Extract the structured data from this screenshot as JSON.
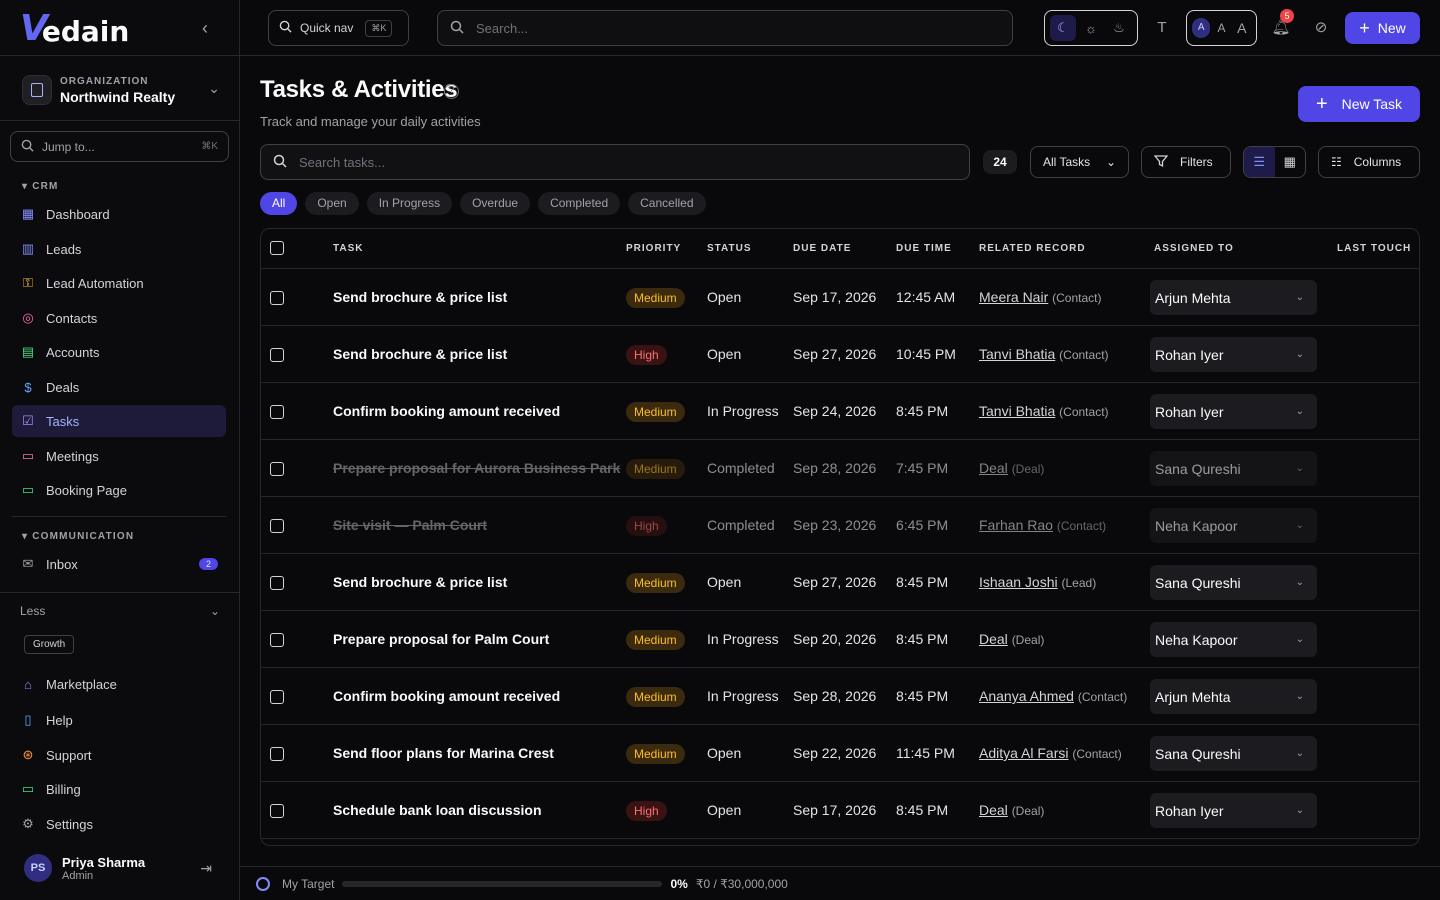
{
  "app": {
    "logo_mark": "V",
    "logo_text": "edain"
  },
  "org": {
    "label": "ORGANIZATION",
    "name": "Northwind Realty"
  },
  "jump": {
    "placeholder": "Jump to...",
    "shortcut": "⌘K"
  },
  "sidebar": {
    "crm_title": "CRM",
    "crm_items": [
      {
        "label": "Dashboard",
        "icon": "dashboard-icon"
      },
      {
        "label": "Leads",
        "icon": "leads-icon"
      },
      {
        "label": "Lead Automation",
        "icon": "automation-icon"
      },
      {
        "label": "Contacts",
        "icon": "contacts-icon"
      },
      {
        "label": "Accounts",
        "icon": "accounts-icon"
      },
      {
        "label": "Deals",
        "icon": "dollar-icon"
      },
      {
        "label": "Tasks",
        "icon": "tasks-icon",
        "active": true
      },
      {
        "label": "Meetings",
        "icon": "calendar-icon"
      },
      {
        "label": "Booking Page",
        "icon": "booking-icon"
      }
    ],
    "comm_title": "COMMUNICATION",
    "comm_items": [
      {
        "label": "Inbox",
        "icon": "inbox-icon",
        "badge": "2"
      }
    ],
    "less_label": "Less",
    "growth_label": "Growth",
    "footer_items": [
      {
        "label": "Marketplace",
        "icon": "marketplace-icon"
      },
      {
        "label": "Help",
        "icon": "book-icon"
      },
      {
        "label": "Support",
        "icon": "support-icon"
      },
      {
        "label": "Billing",
        "icon": "billing-icon"
      },
      {
        "label": "Settings",
        "icon": "settings-icon"
      }
    ],
    "user": {
      "initials": "PS",
      "name": "Priya Sharma",
      "role": "Admin"
    }
  },
  "topbar": {
    "quicknav_label": "Quick nav",
    "quicknav_shortcut": "⌘K",
    "search_placeholder": "Search...",
    "font_sizes": [
      "A",
      "A",
      "A"
    ],
    "notification_count": "5",
    "new_label": "New"
  },
  "page": {
    "title": "Tasks & Activities",
    "subtitle": "Track and manage your daily activities",
    "new_task_label": "New Task",
    "search_placeholder": "Search tasks...",
    "count": "24",
    "view_select": "All Tasks",
    "filters_label": "Filters",
    "columns_label": "Columns",
    "tabs": [
      "All",
      "Open",
      "In Progress",
      "Overdue",
      "Completed",
      "Cancelled"
    ],
    "active_tab": "All"
  },
  "table": {
    "columns": [
      "TASK",
      "PRIORITY",
      "STATUS",
      "DUE DATE",
      "DUE TIME",
      "RELATED RECORD",
      "ASSIGNED TO",
      "LAST TOUCH"
    ],
    "rows": [
      {
        "task": "Send brochure & price list",
        "priority": "Medium",
        "status": "Open",
        "due_date": "Sep 17, 2026",
        "due_time": "12:45 AM",
        "related_name": "Meera Nair",
        "related_type": "(Contact)",
        "assigned": "Arjun Mehta",
        "done": false
      },
      {
        "task": "Send brochure & price list",
        "priority": "High",
        "status": "Open",
        "due_date": "Sep 27, 2026",
        "due_time": "10:45 PM",
        "related_name": "Tanvi Bhatia",
        "related_type": "(Contact)",
        "assigned": "Rohan Iyer",
        "done": false
      },
      {
        "task": "Confirm booking amount received",
        "priority": "Medium",
        "status": "In Progress",
        "due_date": "Sep 24, 2026",
        "due_time": "8:45 PM",
        "related_name": "Tanvi Bhatia",
        "related_type": "(Contact)",
        "assigned": "Rohan Iyer",
        "done": false
      },
      {
        "task": "Prepare proposal for Aurora Business Park",
        "priority": "Medium",
        "status": "Completed",
        "due_date": "Sep 28, 2026",
        "due_time": "7:45 PM",
        "related_name": "Deal",
        "related_type": "(Deal)",
        "assigned": "Sana Qureshi",
        "done": true
      },
      {
        "task": "Site visit — Palm Court",
        "priority": "High",
        "status": "Completed",
        "due_date": "Sep 23, 2026",
        "due_time": "6:45 PM",
        "related_name": "Farhan Rao",
        "related_type": "(Contact)",
        "assigned": "Neha Kapoor",
        "done": true
      },
      {
        "task": "Send brochure & price list",
        "priority": "Medium",
        "status": "Open",
        "due_date": "Sep 27, 2026",
        "due_time": "8:45 PM",
        "related_name": "Ishaan Joshi",
        "related_type": "(Lead)",
        "assigned": "Sana Qureshi",
        "done": false
      },
      {
        "task": "Prepare proposal for Palm Court",
        "priority": "Medium",
        "status": "In Progress",
        "due_date": "Sep 20, 2026",
        "due_time": "8:45 PM",
        "related_name": "Deal",
        "related_type": "(Deal)",
        "assigned": "Neha Kapoor",
        "done": false
      },
      {
        "task": "Confirm booking amount received",
        "priority": "Medium",
        "status": "In Progress",
        "due_date": "Sep 28, 2026",
        "due_time": "8:45 PM",
        "related_name": "Ananya Ahmed",
        "related_type": "(Contact)",
        "assigned": "Arjun Mehta",
        "done": false
      },
      {
        "task": "Send floor plans for Marina Crest",
        "priority": "Medium",
        "status": "Open",
        "due_date": "Sep 22, 2026",
        "due_time": "11:45 PM",
        "related_name": "Aditya Al Farsi",
        "related_type": "(Contact)",
        "assigned": "Sana Qureshi",
        "done": false
      },
      {
        "task": "Schedule bank loan discussion",
        "priority": "High",
        "status": "Open",
        "due_date": "Sep 17, 2026",
        "due_time": "8:45 PM",
        "related_name": "Deal",
        "related_type": "(Deal)",
        "assigned": "Rohan Iyer",
        "done": false
      }
    ]
  },
  "target": {
    "label": "My Target",
    "percent_text": "0%",
    "progress_fraction": 0,
    "amount": "₹0 / ₹30,000,000"
  },
  "colors": {
    "accent": "#4f46e5",
    "medium": "#fbbf24",
    "high": "#f87171",
    "background": "#09090b"
  }
}
